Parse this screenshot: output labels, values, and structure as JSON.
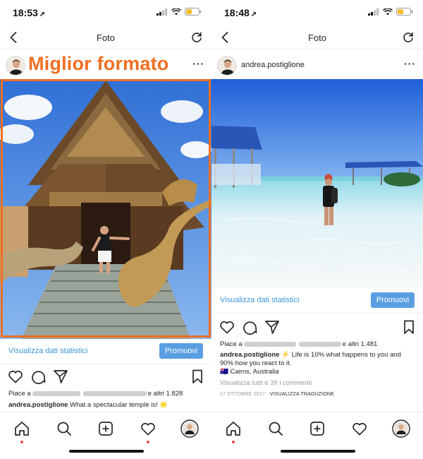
{
  "left": {
    "status": {
      "time": "18:53"
    },
    "nav": {
      "title": "Foto"
    },
    "post": {
      "overlay_label": "Miglior formato",
      "stats_link": "Visualizza dati statistici",
      "promote_label": "Promuovi",
      "likes_prefix": "Piace a",
      "likes_suffix": "e altri 1.828",
      "caption_user": "andrea.postiglione",
      "caption_text": "What a spectacular temple is! 🌟"
    },
    "accent_color": "#ee6f22"
  },
  "right": {
    "status": {
      "time": "18:48"
    },
    "nav": {
      "title": "Foto"
    },
    "post": {
      "username": "andrea.postiglione",
      "stats_link": "Visualizza dati statistici",
      "promote_label": "Promuovi",
      "likes_prefix": "Piace a",
      "likes_suffix": "e altri 1.481",
      "caption_user": "andrea.postiglione",
      "caption_line1": "⚡ Life is 10% what happens to you and",
      "caption_line2": "90% how you react to it.",
      "location": "🇦🇺 Cairns, Australia",
      "comments_link": "Visualizza tutti e 39 i commenti",
      "date": "17 OTTOBRE 2017",
      "translate": "VISUALIZZA TRADUZIONE"
    }
  },
  "colors": {
    "link": "#3b95d8",
    "button": "#5a9ee2",
    "notification_dot": "#ed4956"
  },
  "icons": [
    "back-arrow-icon",
    "refresh-icon",
    "more-icon",
    "heart-icon",
    "comment-icon",
    "share-icon",
    "bookmark-icon",
    "home-icon",
    "search-icon",
    "add-icon",
    "activity-icon",
    "profile-icon",
    "signal-icon",
    "wifi-icon",
    "battery-icon",
    "location-arrow-icon"
  ]
}
